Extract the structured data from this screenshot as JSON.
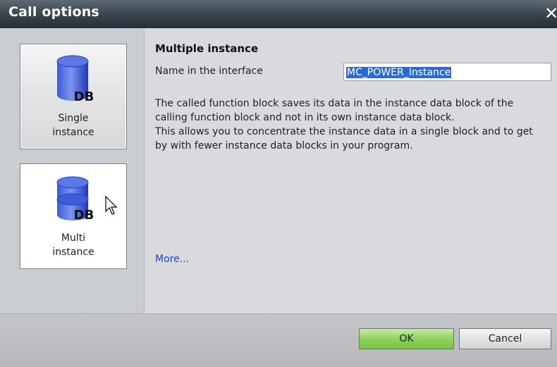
{
  "dialog": {
    "title": "Call options",
    "close_label": "✕"
  },
  "options": {
    "single": {
      "label": "Single\ninstance",
      "badge": "DB",
      "selected": true
    },
    "multi": {
      "label": "Multi\ninstance",
      "badge": "DB",
      "selected": false
    }
  },
  "details": {
    "heading": "Multiple instance",
    "name_label": "Name in the interface",
    "name_value": "MC_POWER_Instance",
    "paragraph1": "The called function block saves its data in the instance data block of the calling function block and not in its own instance data block.",
    "paragraph2": "This allows you to concentrate the instance data in a single block and to get by with fewer instance data blocks in your program.",
    "more_link": "More..."
  },
  "buttons": {
    "ok": "OK",
    "cancel": "Cancel"
  },
  "colors": {
    "titlebar": "#2b353c",
    "ok_green": "#8fd25e",
    "selection": "#2a6ad6",
    "link": "#1b3fe0",
    "db_blue": "#1f3fd0"
  },
  "icons": {
    "single": "database-cylinder-icon",
    "multi": "database-stacked-icon",
    "cursor": "mouse-pointer-icon"
  }
}
